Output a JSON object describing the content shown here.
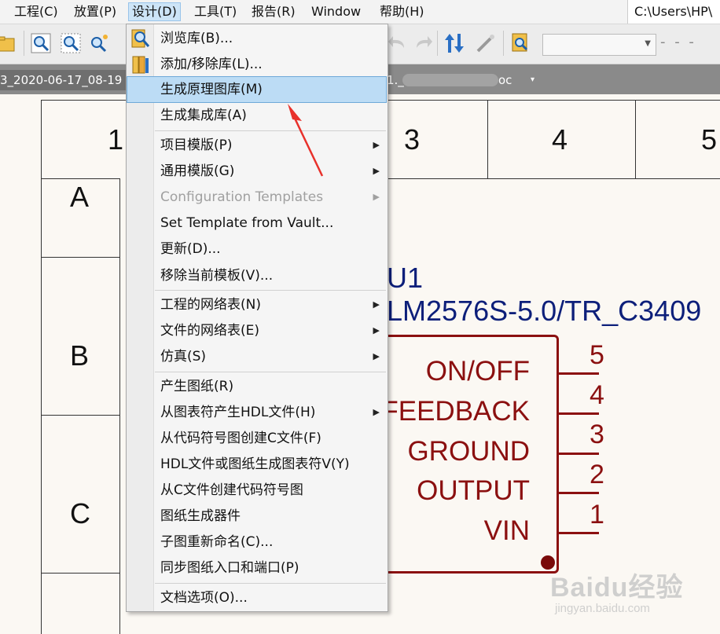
{
  "menubar": {
    "items": [
      {
        "label": "工程(C)"
      },
      {
        "label": "放置(P)"
      },
      {
        "label": "设计(D)"
      },
      {
        "label": "工具(T)"
      },
      {
        "label": "报告(R)"
      },
      {
        "label": "Window"
      },
      {
        "label": "帮助(H)"
      }
    ],
    "path": "C:\\Users\\HP\\"
  },
  "tabs": {
    "doc1": "3_2020-06-17_08-19",
    "doc2_prefix": "1._",
    "doc2_suffix": "oc",
    "doc2_dropdown": "▾"
  },
  "sheet": {
    "columns": [
      "1",
      "3",
      "4",
      "5"
    ],
    "rows": [
      "A",
      "B",
      "C"
    ]
  },
  "component": {
    "designator": "U1",
    "comment": "LM2576S-5.0/TR_C3409",
    "pins": [
      {
        "name": "ON/OFF",
        "number": "5"
      },
      {
        "name": "FEEDBACK",
        "number": "4"
      },
      {
        "name": "GROUND",
        "number": "3"
      },
      {
        "name": "OUTPUT",
        "number": "2"
      },
      {
        "name": "VIN",
        "number": "1"
      }
    ]
  },
  "design_menu": {
    "items": [
      {
        "label": "浏览库(B)...",
        "submenu": false,
        "enabled": true,
        "icon": "browse-library-icon"
      },
      {
        "label": "添加/移除库(L)...",
        "submenu": false,
        "enabled": true,
        "icon": "add-remove-library-icon"
      },
      {
        "label": "生成原理图库(M)",
        "submenu": false,
        "enabled": true,
        "highlighted": true
      },
      {
        "label": "生成集成库(A)",
        "submenu": false,
        "enabled": true
      },
      {
        "label": "项目模版(P)",
        "submenu": true,
        "enabled": true
      },
      {
        "label": "通用模版(G)",
        "submenu": true,
        "enabled": true
      },
      {
        "label": "Configuration Templates",
        "submenu": true,
        "enabled": false
      },
      {
        "label": "Set Template from Vault...",
        "submenu": false,
        "enabled": true
      },
      {
        "label": "更新(D)...",
        "submenu": false,
        "enabled": true
      },
      {
        "label": "移除当前模板(V)...",
        "submenu": false,
        "enabled": true
      },
      {
        "label": "工程的网络表(N)",
        "submenu": true,
        "enabled": true
      },
      {
        "label": "文件的网络表(E)",
        "submenu": true,
        "enabled": true
      },
      {
        "label": "仿真(S)",
        "submenu": true,
        "enabled": true
      },
      {
        "label": "产生图纸(R)",
        "submenu": false,
        "enabled": true
      },
      {
        "label": "从图表符产生HDL文件(H)",
        "submenu": true,
        "enabled": true
      },
      {
        "label": "从代码符号图创建C文件(F)",
        "submenu": false,
        "enabled": true
      },
      {
        "label": "HDL文件或图纸生成图表符V(Y)",
        "submenu": false,
        "enabled": true
      },
      {
        "label": "从C文件创建代码符号图",
        "submenu": false,
        "enabled": true
      },
      {
        "label": "图纸生成器件",
        "submenu": false,
        "enabled": true
      },
      {
        "label": "子图重新命名(C)...",
        "submenu": false,
        "enabled": true
      },
      {
        "label": "同步图纸入口和端口(P)",
        "submenu": false,
        "enabled": true
      },
      {
        "label": "文档选项(O)...",
        "submenu": false,
        "enabled": true
      }
    ],
    "submenu_arrow": "▶"
  },
  "colors": {
    "schematic_red": "#8b1010",
    "designator_blue": "#0d1f7a",
    "menu_highlight": "#bcdcf5",
    "annotation_red": "#e8312b"
  },
  "watermark": {
    "main": "Baidu经验",
    "sub": "jingyan.baidu.com"
  }
}
